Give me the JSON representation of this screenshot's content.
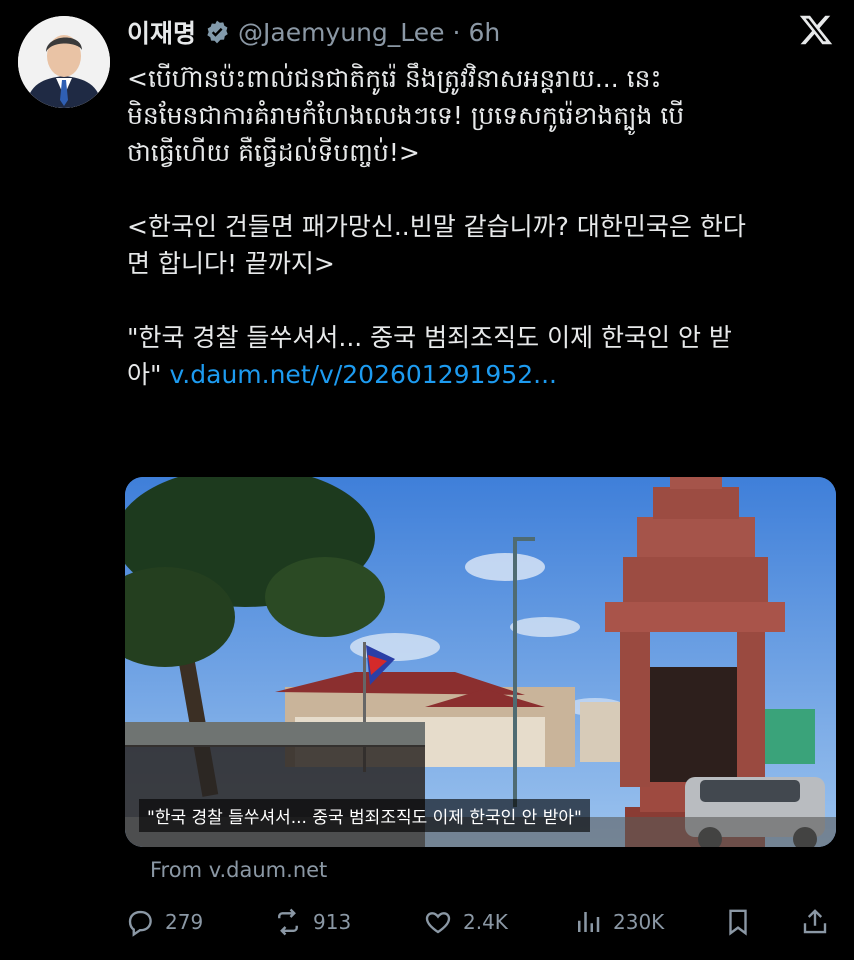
{
  "author": {
    "name": "이재명",
    "handle": "@Jaemyung_Lee",
    "separator": "·",
    "time": "6h"
  },
  "tweet": {
    "khmer_text": "<បើហ៊ានប៉ះពាល់ជនជាតិកូរ៉េ នឹងត្រូវវិនាសអន្តរាយ... នេះ\nមិនមែនជាការគំរាមកំហែងលេងៗទេ! ប្រទេសកូរ៉េខាងត្បូង បើ\nថាធ្វើហើយ គឺធ្វើដល់ទីបញ្ចប់!>",
    "korean_text": "<한국인 건들면 패가망신..빈말 같습니까? 대한민국은 한다\n면 합니다! 끝까지>",
    "headline_text": "\"한국 경찰 들쑤셔서... 중국 범죄조직도 이제 한국인 안 받\n아\" ",
    "link_text": "v.daum.net/v/202601291952..."
  },
  "card": {
    "caption": "\"한국 경찰 들쑤셔서... 중국 범죄조직도 이제 한국인 안 받아\"",
    "source": "From v.daum.net"
  },
  "actions": {
    "replies": "279",
    "reposts": "913",
    "likes": "2.4K",
    "views": "230K"
  },
  "icons": [
    "avatar",
    "verified-badge-icon",
    "x-logo-icon",
    "reply-icon",
    "repost-icon",
    "like-icon",
    "views-icon",
    "bookmark-icon",
    "share-icon"
  ],
  "colors": {
    "background": "#000000",
    "text": "#e7e9ea",
    "secondary": "#8b98a5",
    "link": "#1d9bf0"
  }
}
